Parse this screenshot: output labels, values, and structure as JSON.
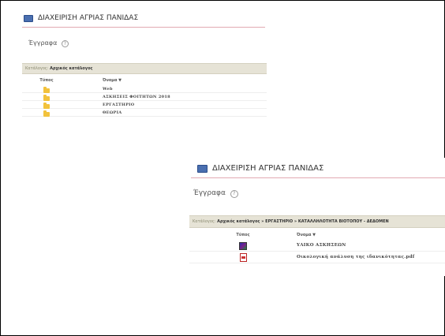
{
  "panel1": {
    "title": "ΔΙΑΧΕΙΡΙΣΗ ΑΓΡΙΑΣ ΠΑΝΙΔΑΣ",
    "section": "Έγγραφα",
    "breadcrumb_label": "Κατάλογος:",
    "breadcrumb_path": "Αρχικός κατάλογος",
    "col_type": "Τύπος",
    "col_name": "Όνομα ▼",
    "rows": [
      {
        "icon": "folder-icon",
        "name": "Web"
      },
      {
        "icon": "folder-icon",
        "name": "ΑΣΚΗΣΕΙΣ ΦΟΙΤΗΤΩΝ 2018"
      },
      {
        "icon": "folder-icon",
        "name": "ΕΡΓΑΣΤΗΡΙΟ"
      },
      {
        "icon": "folder-icon",
        "name": "ΘΕΩΡΙΑ"
      }
    ]
  },
  "panel2": {
    "title": "ΔΙΑΧΕΙΡΙΣΗ ΑΓΡΙΑΣ ΠΑΝΙΔΑΣ",
    "section": "Έγγραφα",
    "breadcrumb_label": "Κατάλογος:",
    "breadcrumb_path": "Αρχικός κατάλογος » ΕΡΓΑΣΤΗΡΙΟ » ΚΑΤΑΛΛΗΛΟΤΗΤΑ ΒΙΟΤΟΠΟΥ - ΔΕΔΟΜΕΝ",
    "col_type": "Τύπος",
    "col_name": "Όνομα ▼",
    "rows": [
      {
        "icon": "archive-icon",
        "name": "ΥΛΙΚΟ ΑΣΚΗΣΕΩΝ"
      },
      {
        "icon": "pdf-icon",
        "name": "Οικολογική ανάλυση της ιδανικότητας.pdf"
      }
    ]
  },
  "help_glyph": "?",
  "colors": {
    "accent_line": "#e2aab2",
    "breadcrumb_bg": "#e6e3d6",
    "folder": "#f2c23c"
  }
}
